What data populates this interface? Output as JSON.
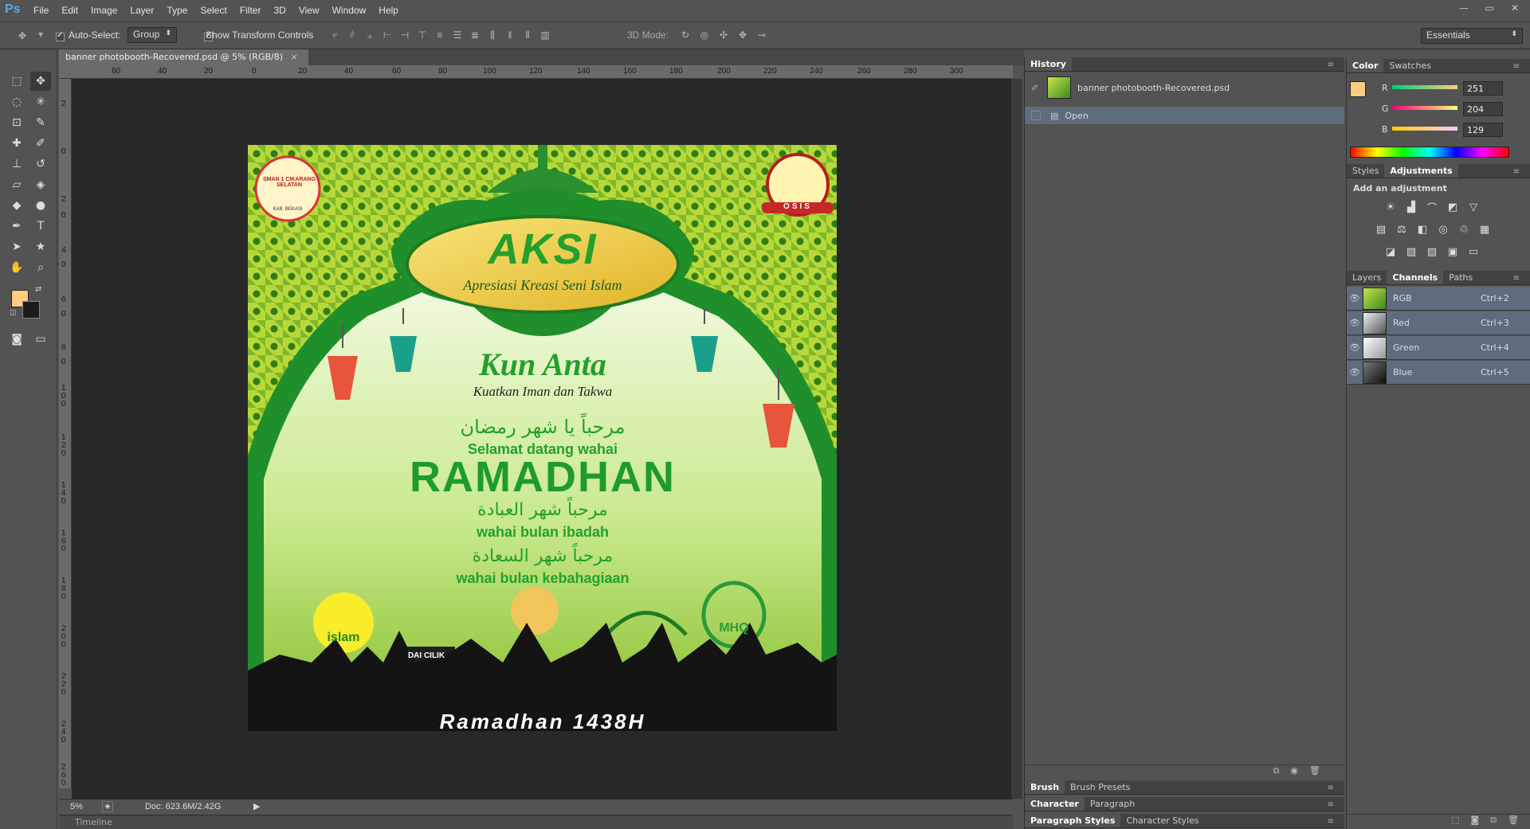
{
  "app": {
    "logo": "Ps"
  },
  "menu": [
    "File",
    "Edit",
    "Image",
    "Layer",
    "Type",
    "Select",
    "Filter",
    "3D",
    "View",
    "Window",
    "Help"
  ],
  "window_controls": [
    "—",
    "▭",
    "✕"
  ],
  "options": {
    "auto_select_label": "Auto-Select:",
    "auto_select_value": "Group",
    "show_transform_label": "Show Transform Controls",
    "mode_3d_label": "3D Mode:",
    "workspace": "Essentials"
  },
  "document": {
    "tab_title": "banner photobooth-Recovered.psd @ 5% (RGB/8)",
    "tab_close": "×",
    "zoom": "5%",
    "doc_info": "Doc: 623.6M/2.42G"
  },
  "ruler_h": [
    "60",
    "40",
    "20",
    "0",
    "20",
    "40",
    "60",
    "80",
    "100",
    "120",
    "140",
    "160",
    "180",
    "200",
    "220",
    "240",
    "260",
    "280",
    "300"
  ],
  "ruler_v": [
    "2",
    "0",
    "2",
    "0",
    "4",
    "0",
    "6",
    "0",
    "8",
    "0",
    "1 0 0",
    "1 2 0",
    "1 4 0",
    "1 6 0",
    "1 8 0",
    "2 0 0",
    "2 2 0",
    "2 4 0",
    "2 6 0"
  ],
  "banner": {
    "title": "AKSI",
    "subtitle": "Apresiasi Kreasi Seni Islam",
    "school_badge": "SMAN 1 CIKARANG SELATAN",
    "school_badge_sub": "KAB. BEKASI",
    "osis_badge": "OSIS",
    "theme": "Kun Anta",
    "theme_sub": "Kuatkan Iman dan Takwa",
    "arabic1": "مرحباً يا شهر رمضان",
    "greet": "Selamat datang wahai",
    "ramadhan": "RAMADHAN",
    "arabic2": "مرحباً شهر العبادة",
    "line2": "wahai bulan ibadah",
    "arabic3": "مرحباً شهر السعادة",
    "line3": "wahai bulan kebahagiaan",
    "logo_islam": "islam",
    "logo_dai": "DAI CILIK",
    "logo_mhq": "MHQ",
    "footer": "Ramadhan 1438H"
  },
  "timeline_label": "Timeline",
  "history": {
    "tab": "History",
    "snapshot": "banner photobooth-Recovered.psd",
    "items": [
      "Open"
    ]
  },
  "color_panel": {
    "tabs": [
      "Color",
      "Swatches"
    ],
    "r_label": "R",
    "r": "251",
    "g_label": "G",
    "g": "204",
    "b_label": "B",
    "b": "129",
    "foreground": "#FBCC81"
  },
  "adjustments": {
    "tabs": [
      "Styles",
      "Adjustments"
    ],
    "heading": "Add an adjustment"
  },
  "channels": {
    "tabs": [
      "Layers",
      "Channels",
      "Paths"
    ],
    "rows": [
      {
        "name": "RGB",
        "shortcut": "Ctrl+2"
      },
      {
        "name": "Red",
        "shortcut": "Ctrl+3"
      },
      {
        "name": "Green",
        "shortcut": "Ctrl+4"
      },
      {
        "name": "Blue",
        "shortcut": "Ctrl+5"
      }
    ]
  },
  "bottom_panels": {
    "brush": [
      "Brush",
      "Brush Presets"
    ],
    "character": [
      "Character",
      "Paragraph"
    ],
    "styles": [
      "Paragraph Styles",
      "Character Styles"
    ]
  }
}
